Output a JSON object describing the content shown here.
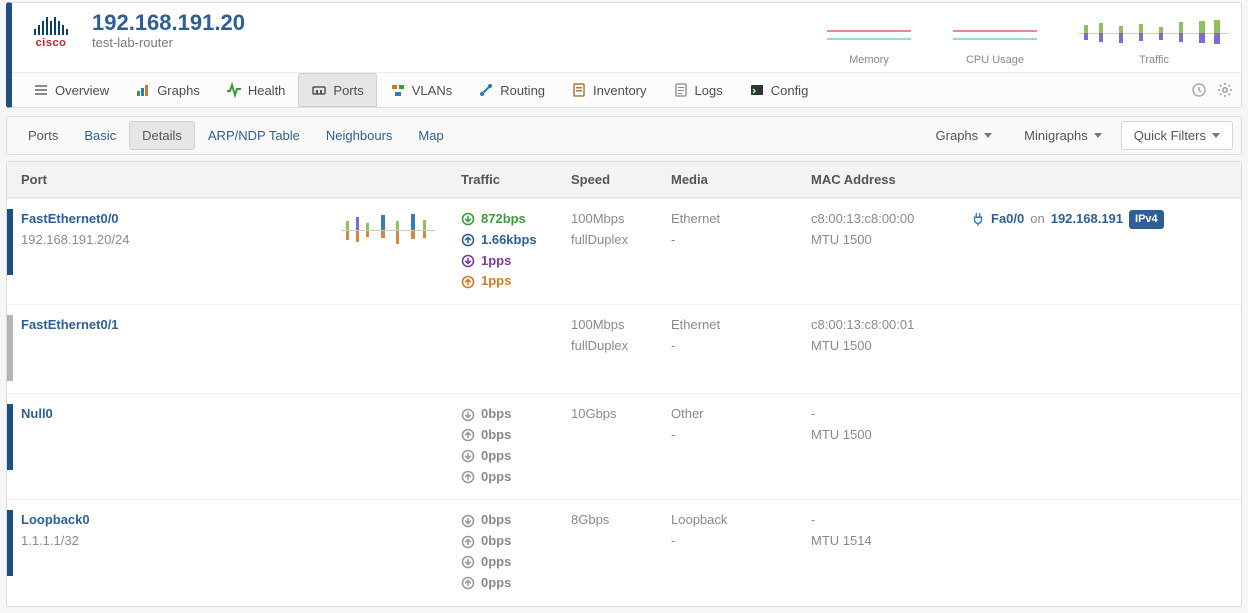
{
  "header": {
    "logo_label": "cisco",
    "ip": "192.168.191.20",
    "hostname": "test-lab-router",
    "sparks": [
      {
        "label": "Memory"
      },
      {
        "label": "CPU Usage"
      },
      {
        "label": "Traffic"
      }
    ]
  },
  "tabs": [
    {
      "id": "overview",
      "label": "Overview"
    },
    {
      "id": "graphs",
      "label": "Graphs"
    },
    {
      "id": "health",
      "label": "Health"
    },
    {
      "id": "ports",
      "label": "Ports",
      "active": true
    },
    {
      "id": "vlans",
      "label": "VLANs"
    },
    {
      "id": "routing",
      "label": "Routing"
    },
    {
      "id": "inventory",
      "label": "Inventory"
    },
    {
      "id": "logs",
      "label": "Logs"
    },
    {
      "id": "config",
      "label": "Config"
    }
  ],
  "subtabs": {
    "items": [
      {
        "id": "ports",
        "label": "Ports"
      },
      {
        "id": "basic",
        "label": "Basic"
      },
      {
        "id": "details",
        "label": "Details",
        "active": true
      },
      {
        "id": "arp",
        "label": "ARP/NDP Table"
      },
      {
        "id": "neigh",
        "label": "Neighbours"
      },
      {
        "id": "map",
        "label": "Map"
      }
    ],
    "right": {
      "graphs": "Graphs",
      "minigraphs": "Minigraphs",
      "quick_filters": "Quick Filters"
    }
  },
  "columns": {
    "port": "Port",
    "traffic": "Traffic",
    "speed": "Speed",
    "media": "Media",
    "mac": "MAC Address"
  },
  "rows": [
    {
      "status": "up",
      "name": "FastEthernet0/0",
      "sub": "192.168.191.20/24",
      "has_spark": true,
      "traffic": [
        {
          "cls": "green",
          "val": "872bps"
        },
        {
          "cls": "blue",
          "val": "1.66kbps"
        },
        {
          "cls": "purple",
          "val": "1pps"
        },
        {
          "cls": "orange",
          "val": "1pps"
        }
      ],
      "speed": "100Mbps",
      "duplex": "fullDuplex",
      "media": "Ethernet",
      "media2": "-",
      "mac": "c8:00:13:c8:00:00",
      "mtu": "MTU 1500",
      "right": {
        "iface": "Fa0/0",
        "on": "on",
        "target": "192.168.191",
        "badge": "IPv4"
      }
    },
    {
      "status": "down",
      "name": "FastEthernet0/1",
      "sub": "",
      "has_spark": false,
      "traffic": [],
      "speed": "100Mbps",
      "duplex": "fullDuplex",
      "media": "Ethernet",
      "media2": "-",
      "mac": "c8:00:13:c8:00:01",
      "mtu": "MTU 1500"
    },
    {
      "status": "up",
      "name": "Null0",
      "sub": "",
      "has_spark": false,
      "traffic": [
        {
          "cls": "grey",
          "val": "0bps"
        },
        {
          "cls": "grey",
          "val": "0bps"
        },
        {
          "cls": "grey",
          "val": "0pps"
        },
        {
          "cls": "grey",
          "val": "0pps"
        }
      ],
      "speed": "10Gbps",
      "duplex": "",
      "media": "Other",
      "media2": "-",
      "mac": "-",
      "mtu": "MTU 1500"
    },
    {
      "status": "up",
      "name": "Loopback0",
      "sub": "1.1.1.1/32",
      "has_spark": false,
      "traffic": [
        {
          "cls": "grey",
          "val": "0bps"
        },
        {
          "cls": "grey",
          "val": "0bps"
        },
        {
          "cls": "grey",
          "val": "0pps"
        },
        {
          "cls": "grey",
          "val": "0pps"
        }
      ],
      "speed": "8Gbps",
      "duplex": "",
      "media": "Loopback",
      "media2": "-",
      "mac": "-",
      "mtu": "MTU 1514"
    }
  ]
}
